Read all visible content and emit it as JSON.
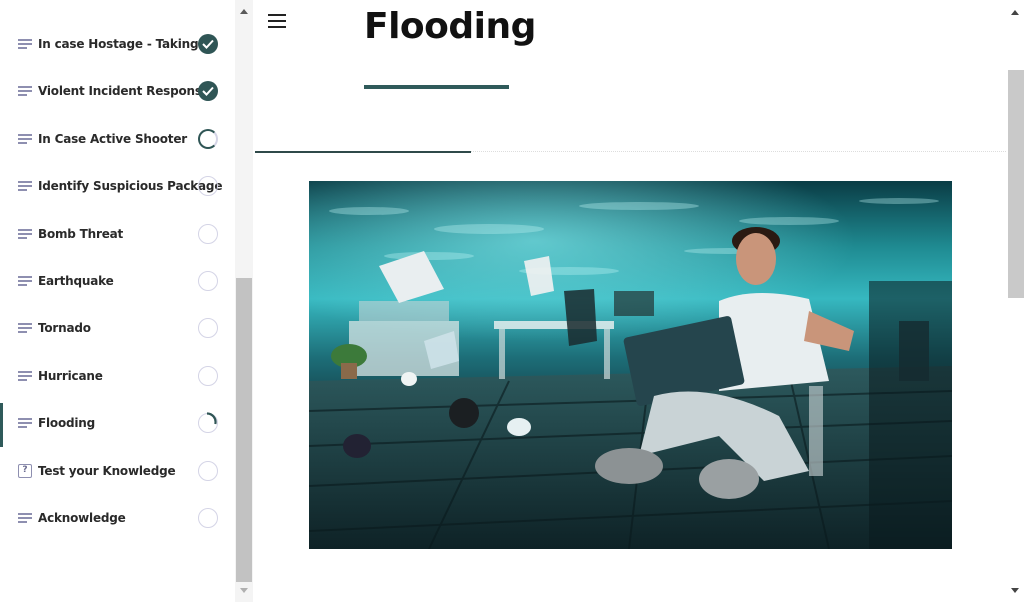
{
  "sidebar": {
    "lessons": [
      {
        "label": "In case Hostage - Taking",
        "icon": "lesson-lines-icon",
        "status": "completed"
      },
      {
        "label": "Violent Incident Response",
        "icon": "lesson-lines-icon",
        "status": "completed"
      },
      {
        "label": "In Case Active Shooter",
        "icon": "lesson-lines-icon",
        "status": "in-progress"
      },
      {
        "label": "Identify Suspicious Package",
        "icon": "lesson-lines-icon",
        "status": "not-started"
      },
      {
        "label": "Bomb Threat",
        "icon": "lesson-lines-icon",
        "status": "not-started"
      },
      {
        "label": "Earthquake",
        "icon": "lesson-lines-icon",
        "status": "not-started"
      },
      {
        "label": "Tornado",
        "icon": "lesson-lines-icon",
        "status": "not-started"
      },
      {
        "label": "Hurricane",
        "icon": "lesson-lines-icon",
        "status": "not-started"
      },
      {
        "label": "Flooding",
        "icon": "lesson-lines-icon",
        "status": "started",
        "active": true
      },
      {
        "label": "Test your Knowledge",
        "icon": "quiz-icon",
        "status": "not-started"
      },
      {
        "label": "Acknowledge",
        "icon": "lesson-lines-icon",
        "status": "not-started"
      }
    ]
  },
  "main": {
    "title": "Flooding",
    "menu_icon": "hamburger-menu-icon",
    "hero_image": "flooded-office-man-with-laptop-image"
  },
  "colors": {
    "accent": "#2f5a5a",
    "status_empty": "#d4d4e6",
    "icon": "#8e8fb0"
  }
}
